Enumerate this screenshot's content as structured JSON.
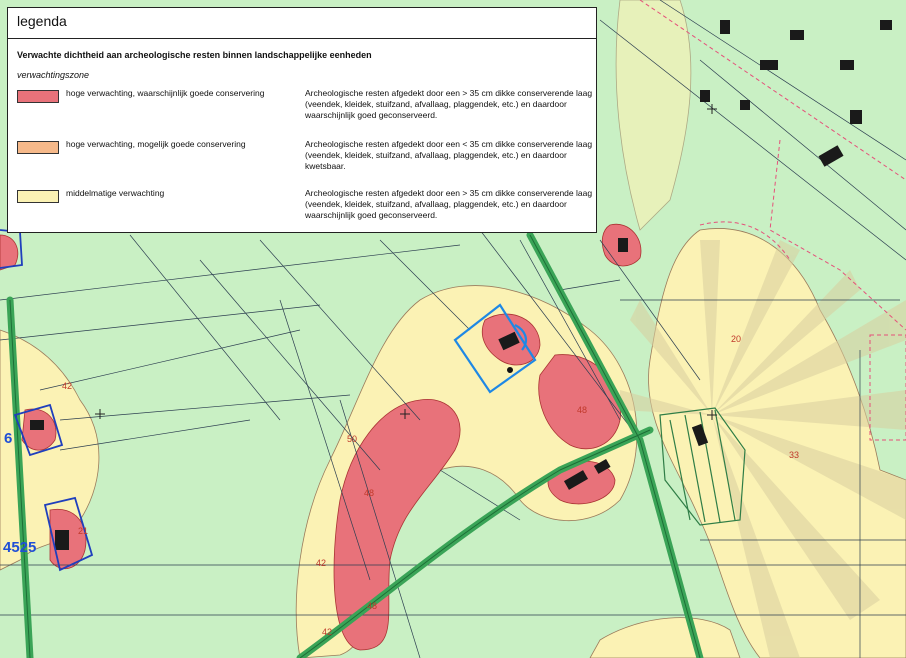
{
  "legend": {
    "title": "legenda",
    "subtitle": "Verwachte dichtheid aan archeologische resten binnen landschappelijke eenheden",
    "zone_heading": "verwachtingszone",
    "items": [
      {
        "label": "hoge verwachting, waarschijnlijk goede conservering",
        "description": "Archeologische resten afgedekt door een > 35 cm dikke conserverende laag (veendek, kleidek, stuifzand, afvallaag, plaggendek, etc.) en daardoor waarschijnlijk goed geconserveerd.",
        "color": "#e8727a"
      },
      {
        "label": "hoge verwachting, mogelijk goede conservering",
        "description": "Archeologische resten afgedekt door een < 35 cm dikke conserverende laag (veendek, kleidek, stuifzand, afvallaag, plaggendek, etc.) en daardoor kwetsbaar.",
        "color": "#f6b98a"
      },
      {
        "label": "middelmatige verwachting",
        "description": "Archeologische resten afgedekt door een > 35 cm dikke conserverende laag (veendek, kleidek, stuifzand, afvallaag, plaggendek, etc.) en daardoor waarschijnlijk goed geconserveerd.",
        "color": "#fbf2b4"
      }
    ]
  },
  "map": {
    "colors": {
      "background": "#c9f0c4",
      "medium": "#fbf2b4",
      "high": "#e8727a",
      "road": "#3aa457",
      "parcel_blue": "#1e88e5",
      "label_red": "#c0392b"
    },
    "zone_labels": [
      "42",
      "50",
      "48",
      "48",
      "48",
      "42",
      "42",
      "20",
      "33",
      "21"
    ],
    "parcel_labels": [
      "6",
      "4525"
    ]
  }
}
